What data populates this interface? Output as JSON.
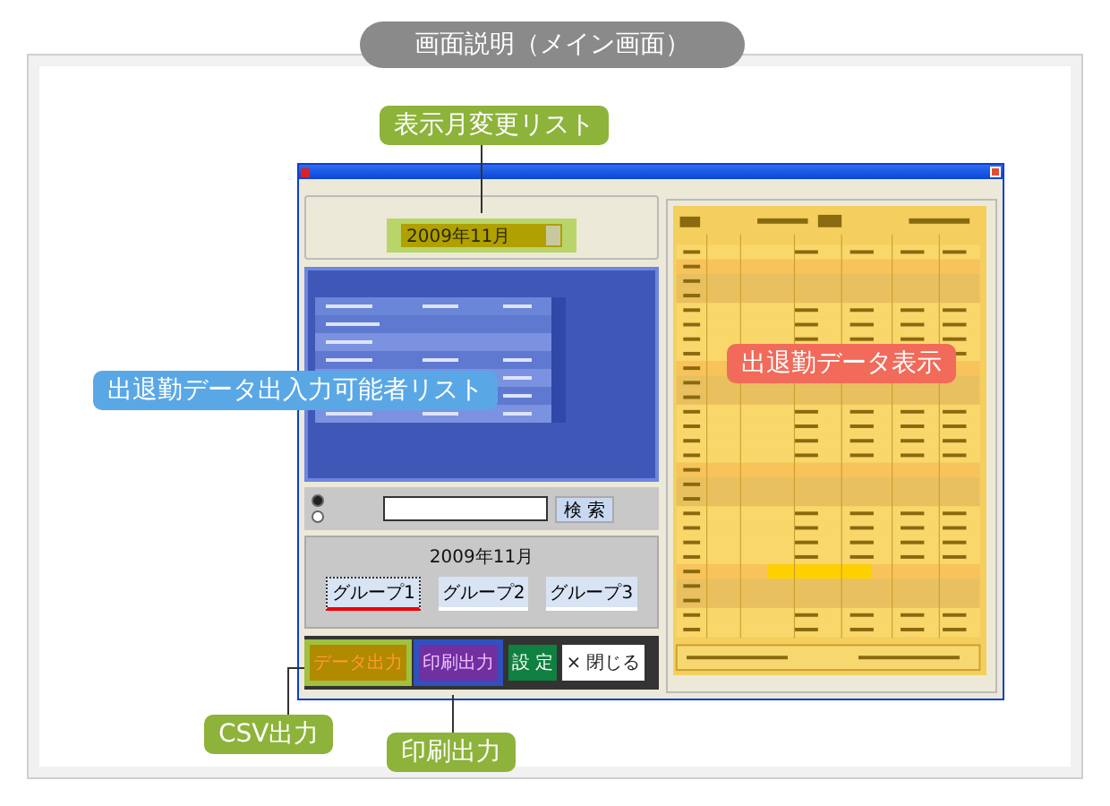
{
  "title": "画面説明（メイン画面）",
  "app_window": {
    "month_select": {
      "value": "2009年11月"
    },
    "radio_options": [
      {
        "selected": true
      },
      {
        "selected": false
      }
    ],
    "search_button": "検 索",
    "group_panel": {
      "heading": "2009年11月",
      "groups": [
        {
          "label": "グループ1",
          "selected": true
        },
        {
          "label": "グループ2",
          "selected": false
        },
        {
          "label": "グループ3",
          "selected": false
        }
      ]
    },
    "buttons": [
      {
        "label": "データ出力",
        "kind": "csv"
      },
      {
        "label": "印刷出力",
        "kind": "print"
      },
      {
        "label": "設 定",
        "kind": "settings"
      },
      {
        "label": "× 閉じる",
        "kind": "close"
      }
    ]
  },
  "callouts": [
    {
      "text": "表示月変更リスト",
      "color": "#8db33a",
      "kind": "month"
    },
    {
      "text": "出退勤データ出入力可能者リスト",
      "color": "#5aa7e6",
      "kind": "list"
    },
    {
      "text": "出退勤データ表示",
      "color": "#f26a5a",
      "kind": "data"
    },
    {
      "text": "CSV出力",
      "color": "#8db33a",
      "kind": "csv"
    },
    {
      "text": "印刷出力",
      "color": "#8db33a",
      "kind": "print"
    }
  ]
}
